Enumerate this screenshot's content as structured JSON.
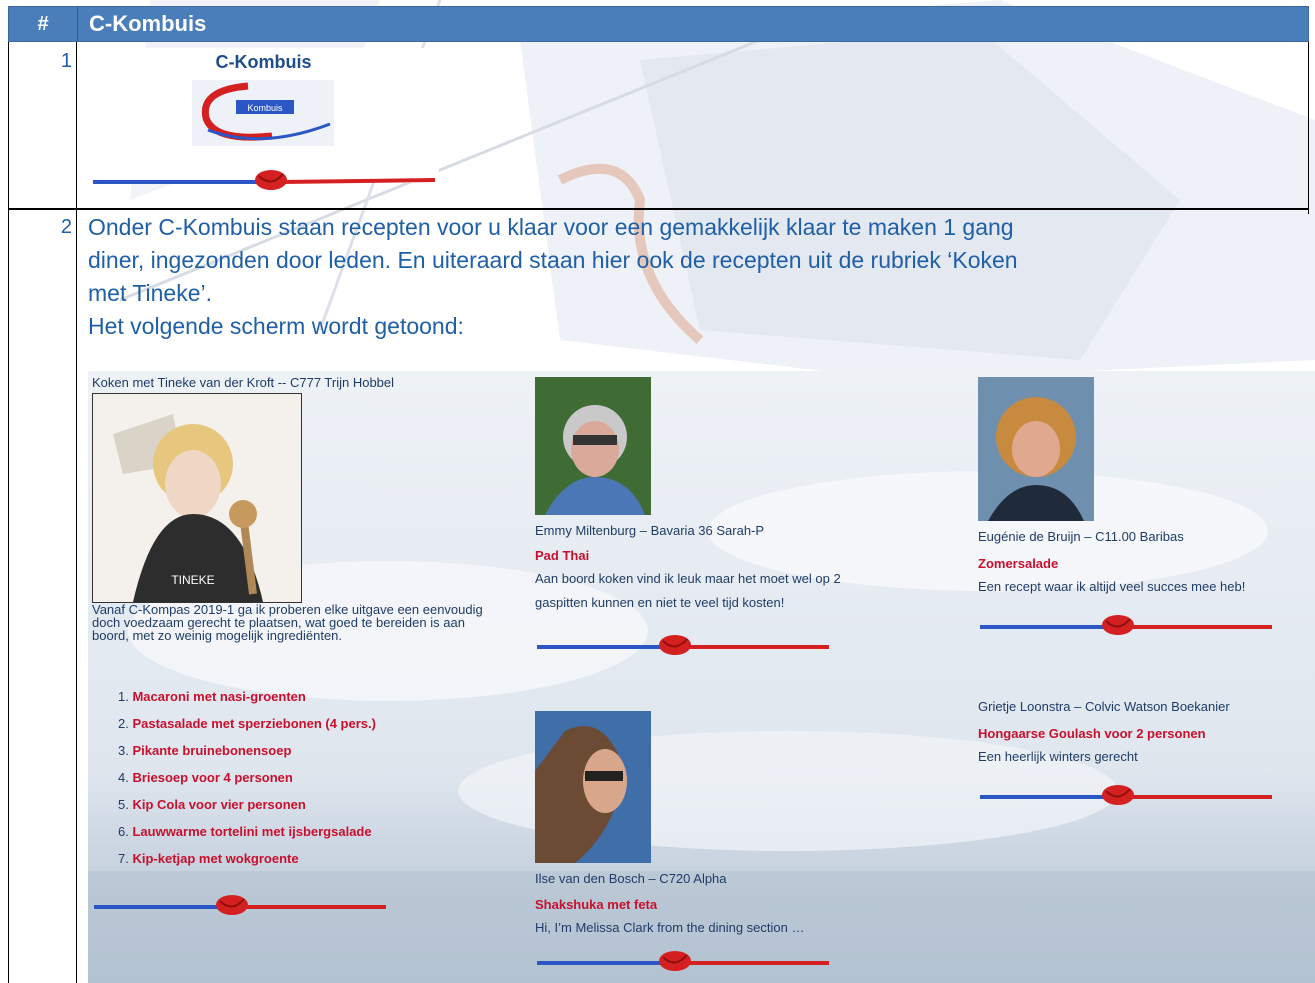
{
  "header": {
    "hash": "#",
    "title": "C-Kombuis"
  },
  "rows": [
    {
      "number": "1",
      "logo_title": "C-Kombuis",
      "logo_badge": "Kombuis"
    },
    {
      "number": "2",
      "intro_line1": "Onder C-Kombuis staan recepten voor u klaar voor een gemakkelijk klaar te maken 1 gang",
      "intro_line2": "diner, ingezonden door leden. En uiteraard staan hier ook de recepten uit de rubriek ‘Koken",
      "intro_line3": "met Tineke’.",
      "intro_line4": "Het volgende scherm wordt getoond:"
    }
  ],
  "screen": {
    "tineke": {
      "heading": "Koken met Tineke van der Kroft -- C777 Trijn Hobbel",
      "apron_text": "TINEKE",
      "paragraph": "Vanaf C-Kompas 2019-1 ga ik proberen elke uitgave een eenvoudig doch voedzaam gerecht te plaatsen, wat goed te bereiden is aan boord, met zo weinig mogelijk ingrediënten.",
      "recipes": [
        {
          "num": "1.",
          "title": "Macaroni met nasi-groenten"
        },
        {
          "num": "2.",
          "title": "Pastasalade met sperziebonen (4 pers.)"
        },
        {
          "num": "3.",
          "title": "Pikante bruinebonensoep"
        },
        {
          "num": "4.",
          "title": "Briesoep voor 4 personen"
        },
        {
          "num": "5.",
          "title": "Kip Cola voor vier personen"
        },
        {
          "num": "6.",
          "title": "Lauwwarme tortelini met ijsbergsalade"
        },
        {
          "num": "7.",
          "title": "Kip-ketjap met wokgroente"
        }
      ]
    },
    "members": [
      {
        "name": "Emmy Miltenburg – Bavaria 36 Sarah-P",
        "recipe": "Pad Thai",
        "desc_line1": "Aan boord koken vind ik leuk maar het moet wel op 2",
        "desc_line2": "gaspitten kunnen en niet te veel tijd kosten!"
      },
      {
        "name": "Ilse van den Bosch – C720 Alpha",
        "recipe": "Shakshuka met feta",
        "desc_line1": "Hi, I’m Melissa Clark from the dining section …",
        "desc_line2": ""
      },
      {
        "name": "Eugénie de Bruijn – C11.00 Baribas",
        "recipe": "Zomersalade",
        "desc_line1": "Een recept waar ik altijd veel succes mee heb!",
        "desc_line2": ""
      },
      {
        "name": "Grietje Loonstra – Colvic Watson Boekanier",
        "recipe": "Hongaarse Goulash voor 2 personen",
        "desc_line1": "Een heerlijk winters gerecht",
        "desc_line2": ""
      }
    ]
  },
  "colors": {
    "header_bg": "#4a7ebb",
    "intro_text": "#1f5fa8",
    "recipe_red": "#c8102e",
    "rope_blue": "#2a56c6",
    "rope_red": "#d42020"
  }
}
